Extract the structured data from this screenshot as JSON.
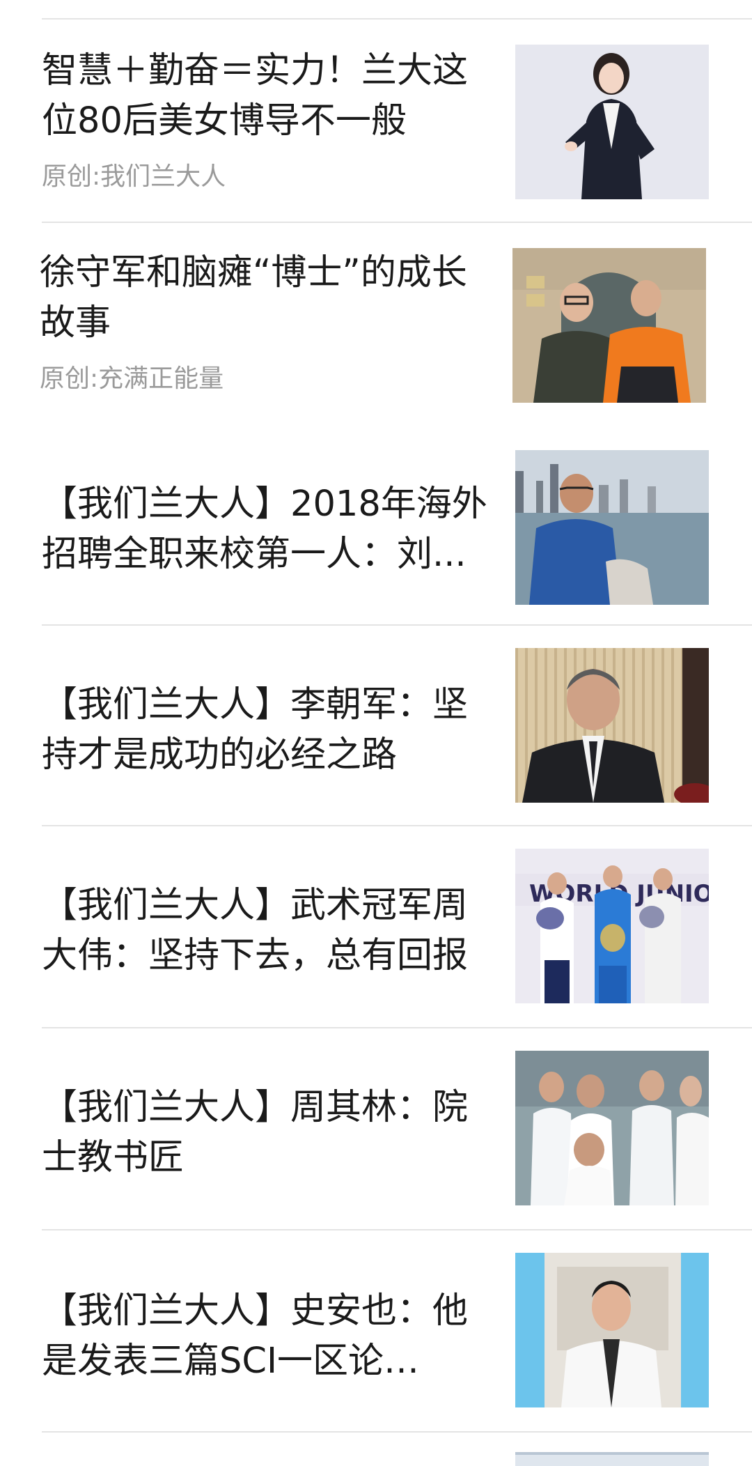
{
  "feed": {
    "items": [
      {
        "title": "智慧＋勤奋＝实力！兰大这位80后美女博导不一般",
        "source": "原创:我们兰大人",
        "image": "woman-portrait"
      },
      {
        "title": "徐守军和脑瘫“博士”的成长故事",
        "source": "原创:充满正能量",
        "image": "two-men-photo"
      },
      {
        "title": "【我们兰大人】2018年海外招聘全职来校第一人：刘...",
        "source": "",
        "image": "man-riverside-photo"
      },
      {
        "title": "【我们兰大人】李朝军：坚持才是成功的必经之路",
        "source": "",
        "image": "man-in-suit-photo"
      },
      {
        "title": "【我们兰大人】武术冠军周大伟：坚持下去，总有回报",
        "source": "",
        "image": "podium-photo"
      },
      {
        "title": "【我们兰大人】周其林：院士教书匠",
        "source": "",
        "image": "lab-coats-photo"
      },
      {
        "title": "【我们兰大人】史安也：他是发表三篇SCI一区论文、...",
        "source": "",
        "image": "young-man-lab-photo"
      }
    ]
  },
  "podium_banner_text": "WORLD JUNIOR"
}
